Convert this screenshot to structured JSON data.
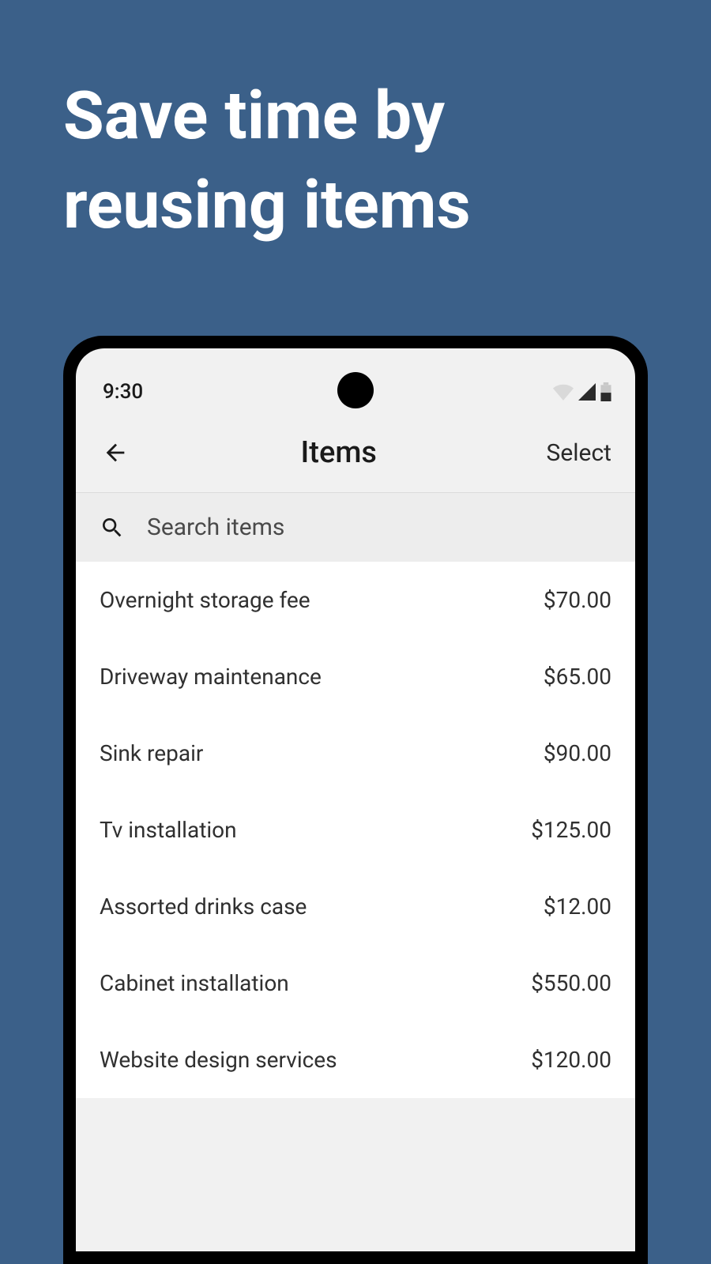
{
  "promo": {
    "heading": "Save time by reusing items"
  },
  "status": {
    "time": "9:30"
  },
  "appbar": {
    "title": "Items",
    "select_label": "Select"
  },
  "search": {
    "placeholder": "Search items"
  },
  "items": [
    {
      "name": "Overnight storage fee",
      "price": "$70.00"
    },
    {
      "name": "Driveway maintenance",
      "price": "$65.00"
    },
    {
      "name": "Sink repair",
      "price": "$90.00"
    },
    {
      "name": "Tv installation",
      "price": "$125.00"
    },
    {
      "name": "Assorted drinks case",
      "price": "$12.00"
    },
    {
      "name": "Cabinet installation",
      "price": "$550.00"
    },
    {
      "name": "Website design services",
      "price": "$120.00"
    }
  ]
}
